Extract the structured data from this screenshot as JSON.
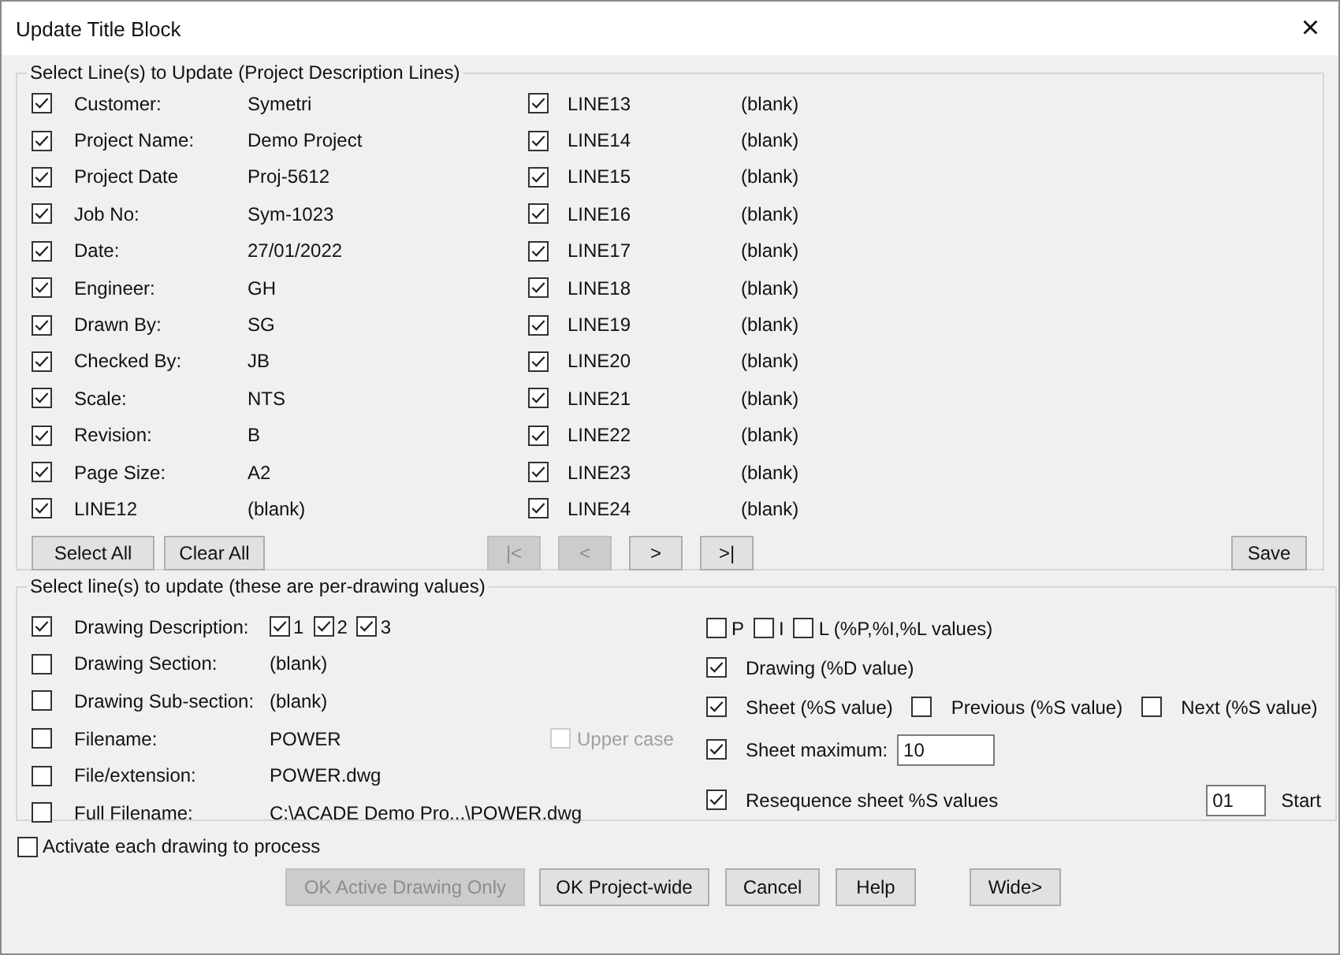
{
  "window": {
    "title": "Update Title Block",
    "close": "×"
  },
  "project_lines": {
    "legend": "Select Line(s) to Update (Project Description Lines)",
    "left": [
      {
        "label": "Customer:",
        "value": "Symetri",
        "checked": true
      },
      {
        "label": "Project Name:",
        "value": "Demo Project",
        "checked": true
      },
      {
        "label": "Project Date",
        "value": "Proj-5612",
        "checked": true
      },
      {
        "label": "Job No:",
        "value": "Sym-1023",
        "checked": true
      },
      {
        "label": "Date:",
        "value": "27/01/2022",
        "checked": true
      },
      {
        "label": "Engineer:",
        "value": "GH",
        "checked": true
      },
      {
        "label": "Drawn By:",
        "value": "SG",
        "checked": true
      },
      {
        "label": "Checked By:",
        "value": "JB",
        "checked": true
      },
      {
        "label": "Scale:",
        "value": "NTS",
        "checked": true
      },
      {
        "label": "Revision:",
        "value": "B",
        "checked": true
      },
      {
        "label": "Page Size:",
        "value": "A2",
        "checked": true
      },
      {
        "label": "LINE12",
        "value": "(blank)",
        "checked": true
      }
    ],
    "right": [
      {
        "label": "LINE13",
        "value": "(blank)",
        "checked": true
      },
      {
        "label": "LINE14",
        "value": "(blank)",
        "checked": true
      },
      {
        "label": "LINE15",
        "value": "(blank)",
        "checked": true
      },
      {
        "label": "LINE16",
        "value": "(blank)",
        "checked": true
      },
      {
        "label": "LINE17",
        "value": "(blank)",
        "checked": true
      },
      {
        "label": "LINE18",
        "value": "(blank)",
        "checked": true
      },
      {
        "label": "LINE19",
        "value": "(blank)",
        "checked": true
      },
      {
        "label": "LINE20",
        "value": "(blank)",
        "checked": true
      },
      {
        "label": "LINE21",
        "value": "(blank)",
        "checked": true
      },
      {
        "label": "LINE22",
        "value": "(blank)",
        "checked": true
      },
      {
        "label": "LINE23",
        "value": "(blank)",
        "checked": true
      },
      {
        "label": "LINE24",
        "value": "(blank)",
        "checked": true
      }
    ],
    "select_buttons": [
      {
        "label": "Select All",
        "disabled": false
      },
      {
        "label": "Clear All",
        "disabled": false
      }
    ],
    "nav_buttons": [
      {
        "label": "|<",
        "disabled": true
      },
      {
        "label": "<",
        "disabled": true
      },
      {
        "label": ">",
        "disabled": false
      },
      {
        "label": ">|",
        "disabled": false
      }
    ],
    "save_button": {
      "label": "Save",
      "disabled": false
    }
  },
  "drawing_lines": {
    "legend": "Select line(s) to update (these are per-drawing values)",
    "left": [
      {
        "kind": "numbered",
        "label": "Drawing Description:",
        "checked": true,
        "parts": [
          {
            "label": "1",
            "checked": true
          },
          {
            "label": "2",
            "checked": true
          },
          {
            "label": "3",
            "checked": true
          }
        ]
      },
      {
        "kind": "value",
        "label": "Drawing Section:",
        "value": "(blank)",
        "checked": false
      },
      {
        "kind": "value",
        "label": "Drawing Sub-section:",
        "value": "(blank)",
        "checked": false
      },
      {
        "kind": "value",
        "label": "Filename:",
        "value": "POWER",
        "checked": false,
        "option": {
          "label": "Upper case",
          "checked": false,
          "disabled": true
        }
      },
      {
        "kind": "value",
        "label": "File/extension:",
        "value": "POWER.dwg",
        "checked": false
      },
      {
        "kind": "value",
        "label": "Full Filename:",
        "value": "C:\\ACADE Demo Pro...\\POWER.dwg",
        "checked": false
      }
    ],
    "right": [
      {
        "kind": "compact",
        "checks": [
          {
            "label": "P",
            "checked": false
          },
          {
            "label": "I",
            "checked": false
          },
          {
            "label": "L (%P,%I,%L values)",
            "checked": false
          }
        ]
      },
      {
        "kind": "checks",
        "checks": [
          {
            "label": "Drawing (%D value)",
            "checked": true
          }
        ]
      },
      {
        "kind": "checks",
        "checks": [
          {
            "label": "Sheet (%S value)",
            "checked": true
          },
          {
            "label": "Previous (%S value)",
            "checked": false
          },
          {
            "label": "Next (%S value)",
            "checked": false
          }
        ]
      },
      {
        "kind": "field",
        "label": "Sheet maximum:",
        "checked": true,
        "value": "10"
      },
      {
        "kind": "start",
        "label": "Resequence sheet %S values",
        "checked": true,
        "value": "01",
        "suffix": "Start"
      }
    ]
  },
  "activate": {
    "label": "Activate each drawing to process",
    "checked": false
  },
  "buttons": [
    {
      "label": "OK Active Drawing Only",
      "disabled": true
    },
    {
      "label": "OK Project-wide",
      "disabled": false
    },
    {
      "label": "Cancel",
      "disabled": false
    },
    {
      "label": "Help",
      "disabled": false
    },
    {
      "label": "Wide>",
      "disabled": false
    }
  ]
}
